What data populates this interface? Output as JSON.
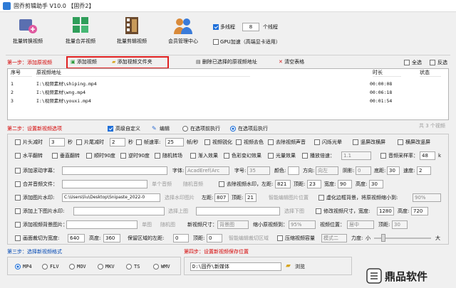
{
  "window": {
    "title": "固乔剪辑助手 V10.0 【固乔2】"
  },
  "toolbar": {
    "buttons": [
      {
        "label": "批量转换视频",
        "icon": "video-convert-icon"
      },
      {
        "label": "批量合并视频",
        "icon": "video-merge-icon"
      },
      {
        "label": "批量剪辑视频",
        "icon": "video-clip-icon"
      },
      {
        "label": "会员管理中心",
        "icon": "member-center-icon"
      }
    ],
    "multithread_label": "多线程",
    "thread_count": "8",
    "thread_unit": "个线程",
    "gpu_label": "GPU加速（高端显卡适用）"
  },
  "step1": {
    "label": "第一步：添加原视频",
    "add_video": "添加视频",
    "add_folder": "添加视频文件夹",
    "delete_selected": "删除已选择的原视频地址",
    "clear_table": "清空表格",
    "select_all": "全选",
    "invert": "反选"
  },
  "table": {
    "columns": [
      "序号",
      "原视频地址",
      "时长",
      "状态"
    ],
    "rows": [
      {
        "no": "1",
        "path": "I:\\视频素材\\shiping.mp4",
        "duration": "00:00:08",
        "status": ""
      },
      {
        "no": "2",
        "path": "I:\\视频素材\\wng.mp4",
        "duration": "00:06:18",
        "status": ""
      },
      {
        "no": "3",
        "path": "I:\\视频素材\\youxi.mp4",
        "duration": "00:01:54",
        "status": ""
      }
    ],
    "count_text": "共 3 个视频"
  },
  "step2": {
    "label": "第二步：设置新视频选项",
    "advanced": "高级自定义",
    "edit": "编辑",
    "before": "在选项前执行",
    "after": "在选项后执行",
    "head_cut": "片头减时",
    "head_val": "3",
    "sec": "秒",
    "tail_cut": "片尾减时",
    "tail_val": "2",
    "sec2": "秒",
    "fps_label": "帧速率:",
    "fps_val": "25",
    "fps_unit": "帧/秒",
    "opt1": [
      "视频锐化",
      "视频去色",
      "去除视频声音",
      "闪烁光晕",
      "竖屏改横屏",
      "横屏改竖屏"
    ],
    "opt2": [
      "水平翻转",
      "垂直翻转",
      "顺时90度",
      "逆时90度",
      "随机转场",
      "渐入效果",
      "色彩变幻效果",
      "光量效果",
      "播放倍速："
    ],
    "speed_val": "1.1",
    "sample_label": "音频采样率：",
    "sample_val": "48",
    "sample_unit": "k",
    "scroll_sub": "添加滚动字幕：",
    "font_label": "字体:",
    "font_val": "AcadEref(Arc",
    "size_label": "字号:",
    "size_val": "35",
    "color_label": "颜色:",
    "dir_label": "方向:",
    "dir_val": "向左",
    "shadow_label": "阴影:",
    "shadow_val": "0",
    "bottom_label": "底距:",
    "bottom_val": "30",
    "speed_label": "速度:",
    "speed2_val": "2",
    "merge_audio": "合并音频文件：",
    "single_audio": "单个音频",
    "random_audio": "随机音频",
    "remove_wm": "去除视频水印，左距:",
    "wm_left": "821",
    "wm_top_label": "顶距:",
    "wm_top": "23",
    "wm_w_label": "宽度:",
    "wm_w": "90",
    "wm_h_label": "高度:",
    "wm_h": "30",
    "add_img_wm": "添加图片水印:",
    "img_path": "C:\\Users\\liu\\Desktop\\Snipaste_2022-0",
    "select_wm": "选择水印图片",
    "img_left_label": "左距:",
    "img_left": "807",
    "img_top_label": "顶距:",
    "img_top": "21",
    "smart_wm": "智能编辑图片位置",
    "blur_bg": "虚化边框背景，将原视频缩小到:",
    "blur_val": "90%",
    "add_topbottom": "添加上下图片水印:",
    "select_top": "选择上图",
    "select_bottom": "选择下图",
    "resize": "修改视频尺寸，宽度:",
    "resize_w": "1280",
    "resize_h_label": "高度:",
    "resize_h": "720",
    "add_bg": "添加视频背景图片：",
    "single_img": "单图",
    "random_img": "随机图",
    "newpos_label": "新视频尺寸：",
    "newpos_val": "背景图",
    "shrink_label": "缩小原视频到：",
    "shrink_val": "95%",
    "vpos_label": "视频位置：",
    "vpos_val": "居中",
    "vtop_label": "顶距:",
    "vtop_val": "30",
    "crop": "画面裁切为宽度:",
    "crop_w": "640",
    "crop_h_label": "高度:",
    "crop_h": "360",
    "keep_left": "保留区域的左距:",
    "keep_left_val": "0",
    "keep_top_label": "顶距:",
    "keep_top_val": "0",
    "smart_crop": "智能编辑裁切区域",
    "compress": "压缩视频容量",
    "mode_val": "模式二",
    "force_label": "力度:",
    "small": "小",
    "big": "大"
  },
  "step3": {
    "label": "第三步：选择新视频格式",
    "formats": [
      "MP4",
      "FLV",
      "MOV",
      "MKV",
      "TS",
      "WMV"
    ]
  },
  "step4": {
    "label": "第四步：设置新视频保存位置",
    "path": "D:\\固乔\\新媒体",
    "browse": "浏览"
  },
  "watermark": {
    "text": "鼎品软件"
  }
}
